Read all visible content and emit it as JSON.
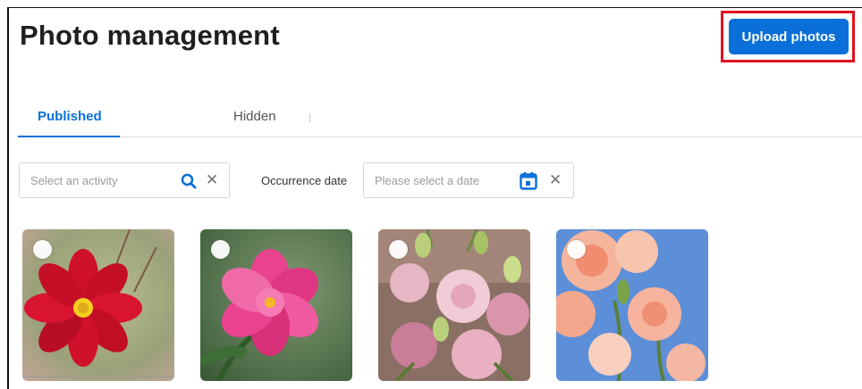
{
  "page": {
    "title": "Photo management",
    "upload_label": "Upload photos"
  },
  "tabs": [
    {
      "label": "Published",
      "active": true
    },
    {
      "label": "Hidden",
      "active": false
    }
  ],
  "filters": {
    "activity_placeholder": "Select an activity",
    "date_label": "Occurrence date",
    "date_placeholder": "Please select a date",
    "clear_glyph": "✕"
  },
  "photos": [
    {
      "subject": "red cosmos flower",
      "selected": false
    },
    {
      "subject": "pink peony flower",
      "selected": false
    },
    {
      "subject": "pink lisianthus bouquet",
      "selected": false
    },
    {
      "subject": "peach roses against blue sky",
      "selected": false
    }
  ],
  "colors": {
    "accent": "#0a6fd9",
    "highlight_border": "#e0121e"
  }
}
